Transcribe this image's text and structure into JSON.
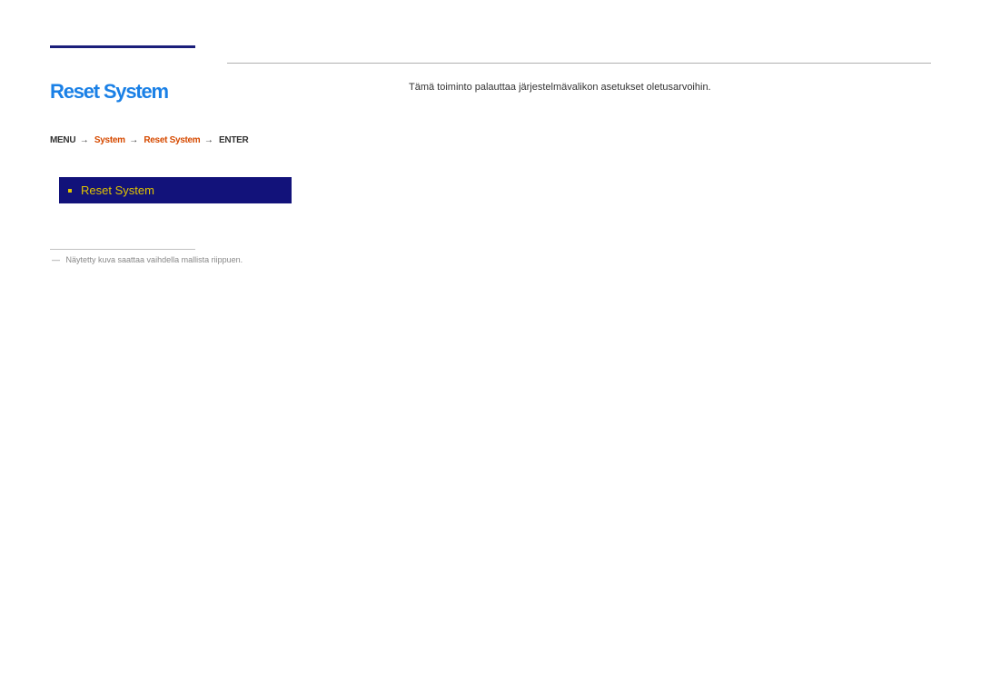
{
  "section": {
    "title": "Reset System"
  },
  "breadcrumb": {
    "menu_icon": "MENU",
    "level1": "System",
    "level2": "Reset System",
    "action": "ENTER"
  },
  "menu_screenshot": {
    "selected_label": "Reset System"
  },
  "description": {
    "text": "Tämä toiminto palauttaa järjestelmävalikon asetukset oletusarvoihin."
  },
  "footnote": {
    "text": "Näytetty kuva saattaa vaihdella mallista riippuen."
  }
}
